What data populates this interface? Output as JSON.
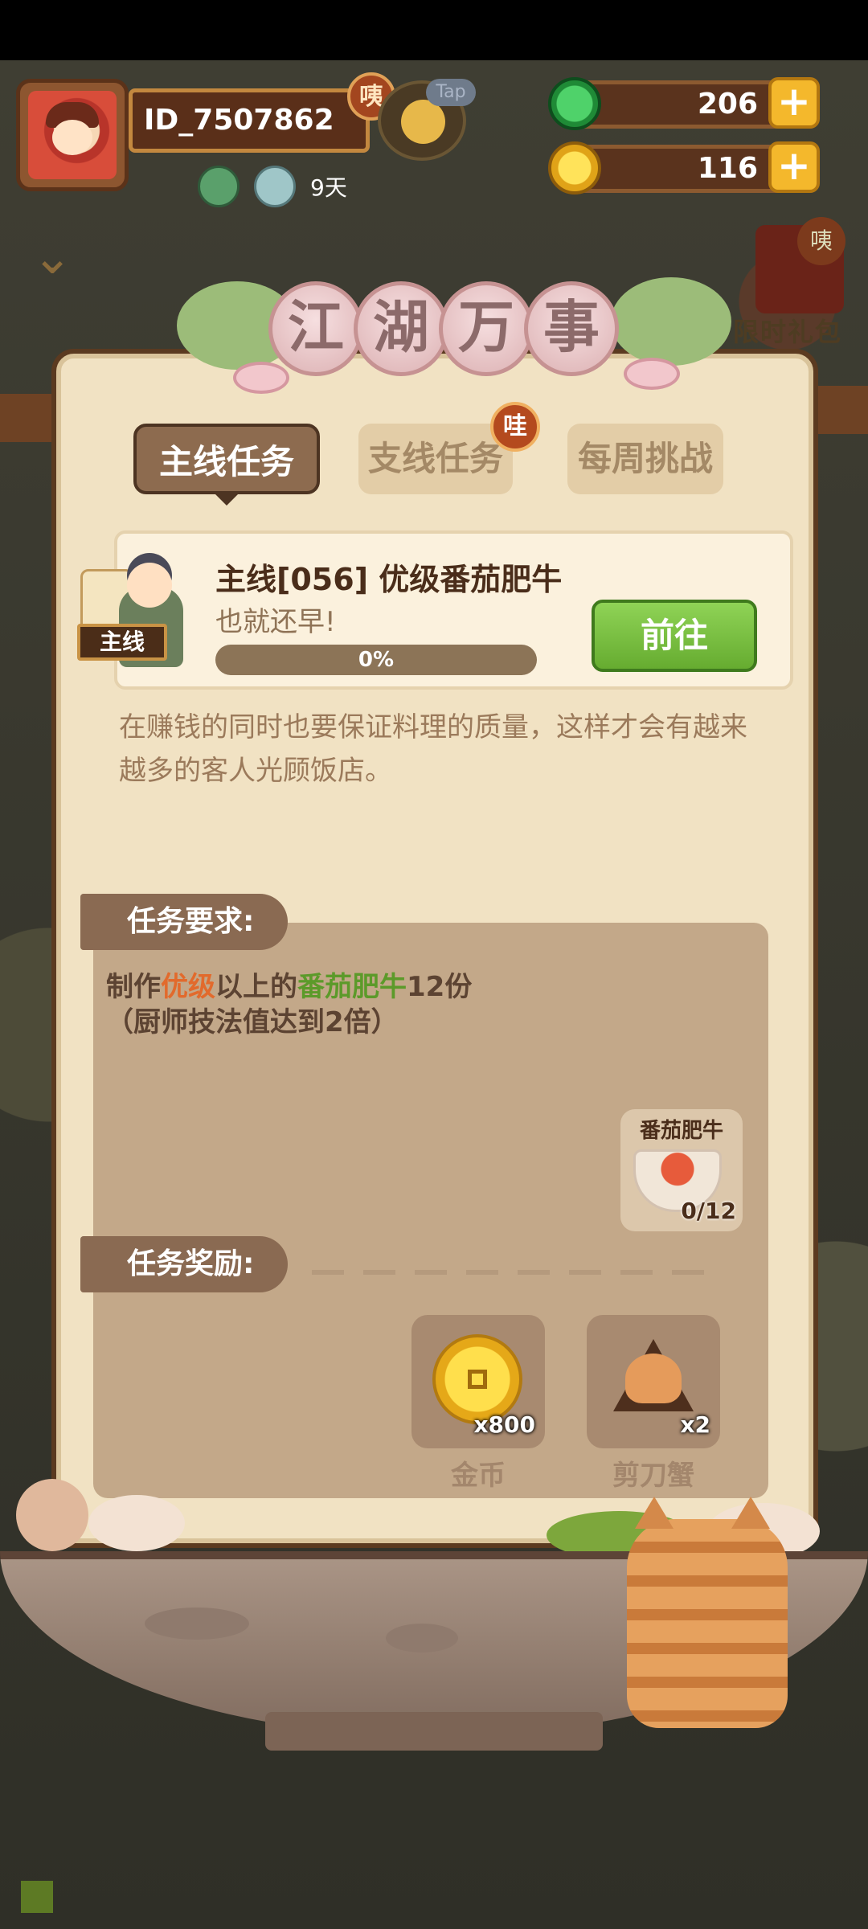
{
  "player": {
    "id": "ID_7507862",
    "badge": "咦",
    "tap_label": "Tap",
    "days": "9天"
  },
  "resources": {
    "jade": "206",
    "coins": "116",
    "plus": "+"
  },
  "side": {
    "gift_badge": "咦",
    "gift_label": "限时礼包"
  },
  "title": {
    "chars": [
      "江",
      "湖",
      "万",
      "事"
    ]
  },
  "tabs": {
    "main": "主线任务",
    "side": "支线任务",
    "weekly": "每周挑战",
    "side_badge": "哇"
  },
  "task": {
    "tag": "主线",
    "title": "主线[056] 优级番茄肥牛",
    "subtitle": "也就还早!",
    "progress_value": 0,
    "progress_text": "0%",
    "go_button": "前往",
    "description": "在赚钱的同时也要保证料理的质量，这样才会有越来越多的客人光顾饭店。"
  },
  "requirement": {
    "header": "任务要求:",
    "line1_a": "制作",
    "line1_b": "优级",
    "line1_c": "以上的",
    "line1_d": "番茄肥牛",
    "line1_e": "12份",
    "line2": "（厨师技法值达到2倍）",
    "dish_name": "番茄肥牛",
    "dish_count": "0/12"
  },
  "rewards": {
    "header": "任务奖励:",
    "items": [
      {
        "name": "金币",
        "count": "x800"
      },
      {
        "name": "剪刀蟹",
        "count": "x2"
      }
    ]
  },
  "colors": {
    "accent_green": "#77b545",
    "highlight_orange": "#e26a2c",
    "highlight_green": "#5c9a2a",
    "panel": "#f1e2c3"
  }
}
